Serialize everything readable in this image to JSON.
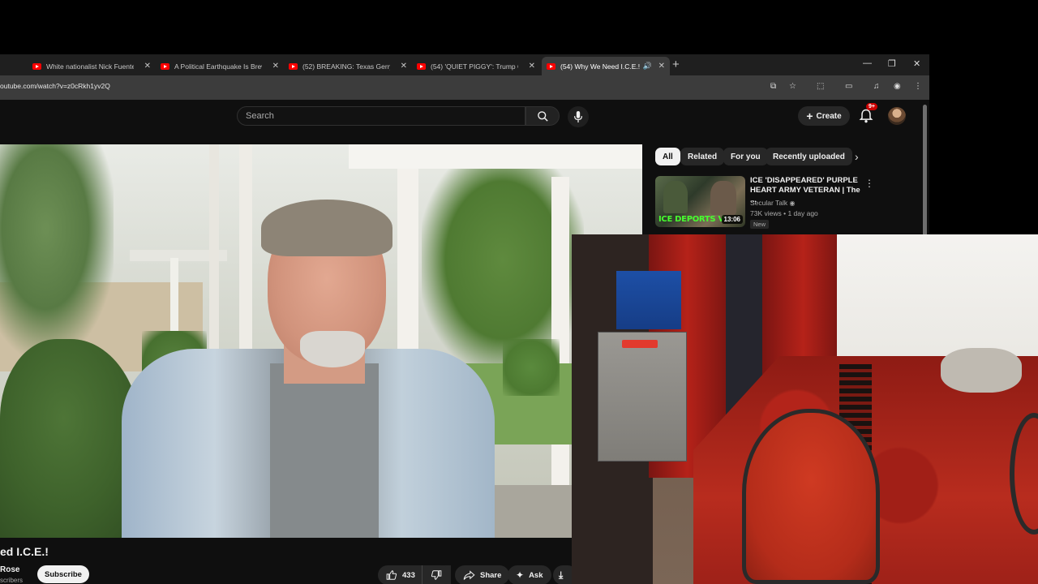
{
  "browser": {
    "tabs": [
      {
        "title": "White nationalist Nick Fuentes",
        "active": false
      },
      {
        "title": "A Political Earthquake Is Brewin",
        "active": false
      },
      {
        "title": "(52) BREAKING: Texas Gerryman",
        "active": false
      },
      {
        "title": "(54) 'QUIET PIGGY': Trump CRA",
        "active": false
      },
      {
        "title": "(54) Why We Need I.C.E.! -",
        "active": true
      }
    ],
    "url": "outube.com/watch?v=z0cRkh1yv2Q"
  },
  "masthead": {
    "search_placeholder": "Search",
    "create_label": "Create",
    "notifications_badge": "9+"
  },
  "sidebar": {
    "chips": [
      {
        "label": "All",
        "selected": true
      },
      {
        "label": "Related",
        "selected": false
      },
      {
        "label": "For you",
        "selected": false
      },
      {
        "label": "Recently uploaded",
        "selected": false
      }
    ],
    "recommended": {
      "thumbnail_text": "ICE DEPORTS V",
      "duration": "13:06",
      "title": "ICE 'DISAPPEARED' PURPLE HEART ARMY VETERAN | The ...",
      "channel": "Secular Talk",
      "meta": "73K views • 1 day ago",
      "badge": "New"
    }
  },
  "video": {
    "title": "ed I.C.E.!",
    "channel": "Rose",
    "subscribers": "scribers",
    "subscribe_label": "Subscribe",
    "likes": "433",
    "share_label": "Share",
    "ask_label": "Ask"
  },
  "colors": {
    "youtube_red": "#ff0000",
    "background": "#0f0f0f",
    "chip_bg": "#272727",
    "badge_red": "#cc0000"
  }
}
